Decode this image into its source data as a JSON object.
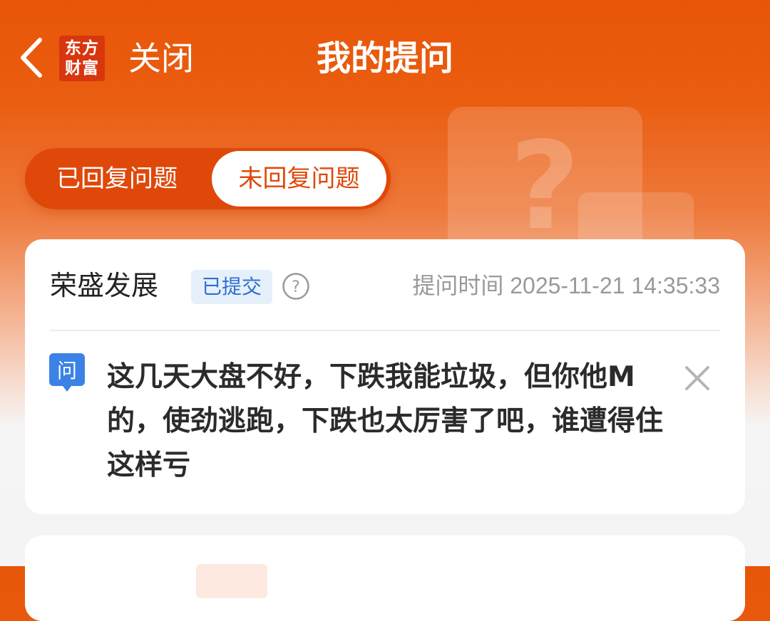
{
  "header": {
    "close_label": "关闭",
    "title": "我的提问",
    "logo_line1": "东方",
    "logo_line2": "财富"
  },
  "tabs": [
    {
      "label": "已回复问题",
      "active": false
    },
    {
      "label": "未回复问题",
      "active": true
    }
  ],
  "question": {
    "stock_name": "荣盛发展",
    "status": "已提交",
    "ask_time": "提问时间 2025-11-21 14:35:33",
    "ask_badge": "问",
    "text": "这几天大盘不好，下跌我能垃圾，但你他M的，使劲逃跑，下跌也太厉害了吧，谁遭得住这样亏"
  },
  "colors": {
    "brand": "#e85508",
    "badge_blue": "#2f6fd1",
    "ask_icon": "#3b82e6"
  }
}
